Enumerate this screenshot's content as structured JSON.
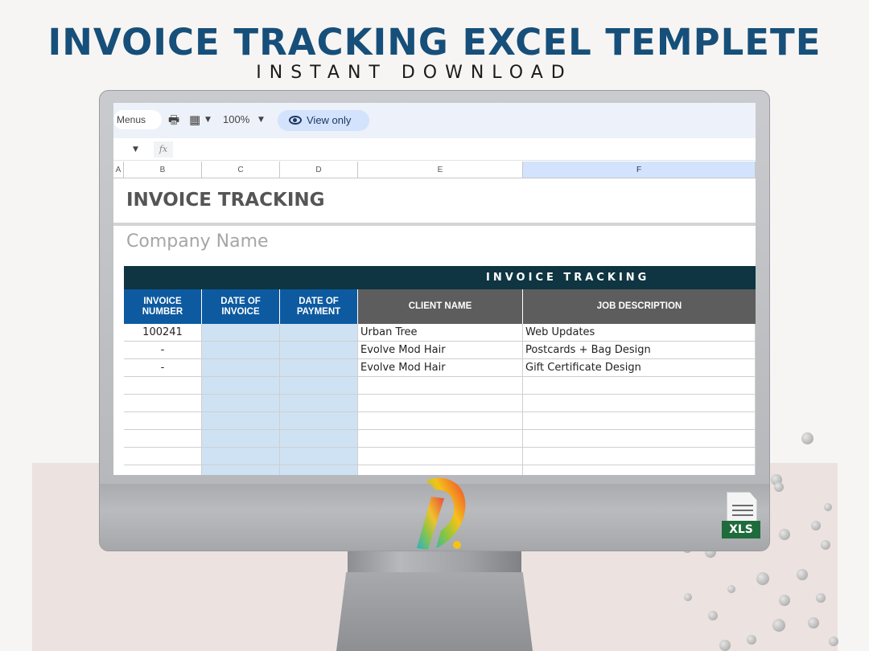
{
  "banner": {
    "title": "INVOICE TRACKING EXCEL TEMPLETE",
    "subtitle": "INSTANT DOWNLOAD"
  },
  "toolbar": {
    "menus_label": "Menus",
    "zoom": "100%",
    "view_only_label": "View only",
    "print_icon": "print-icon",
    "format_icon": "format-icon"
  },
  "formula_bar": {
    "fx_label": "fx"
  },
  "columns": [
    "A",
    "B",
    "C",
    "D",
    "E",
    "F"
  ],
  "sheet": {
    "title": "INVOICE TRACKING",
    "company": "Company Name",
    "section_header": "INVOICE TRACKING",
    "headers": [
      "INVOICE NUMBER",
      "DATE OF INVOICE",
      "DATE OF PAYMENT",
      "CLIENT NAME",
      "JOB DESCRIPTION"
    ],
    "rows": [
      [
        "100241",
        "",
        "",
        "Urban Tree",
        "Web Updates"
      ],
      [
        "-",
        "",
        "",
        "Evolve Mod Hair",
        "Postcards + Bag Design"
      ],
      [
        "-",
        "",
        "",
        "Evolve Mod Hair",
        "Gift Certificate Design"
      ],
      [
        "",
        "",
        "",
        "",
        ""
      ],
      [
        "",
        "",
        "",
        "",
        ""
      ],
      [
        "",
        "",
        "",
        "",
        ""
      ],
      [
        "",
        "",
        "",
        "",
        ""
      ],
      [
        "",
        "",
        "",
        "",
        ""
      ],
      [
        "",
        "",
        "",
        "",
        ""
      ]
    ]
  },
  "file_badge": {
    "label": "XLS"
  },
  "colors": {
    "headline": "#164f7a",
    "banner_dark": "#0e3541",
    "header_blue": "#0d5aa0",
    "header_gray": "#5d5d5d",
    "date_shade": "#cfe2f3",
    "xls_green": "#1f6b3b"
  }
}
